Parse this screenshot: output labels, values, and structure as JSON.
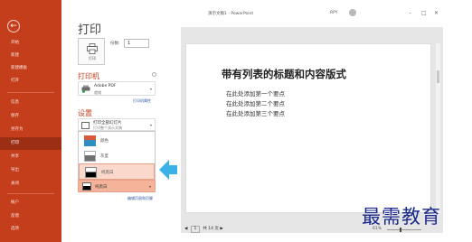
{
  "nav": {
    "items": [
      {
        "label": "开始"
      },
      {
        "label": "新建"
      },
      {
        "label": "新建模板"
      },
      {
        "label": "打开"
      },
      {
        "label": "信息"
      },
      {
        "label": "保存"
      },
      {
        "label": "另存为"
      },
      {
        "label": "打印"
      },
      {
        "label": "共享"
      },
      {
        "label": "导出"
      },
      {
        "label": "关闭"
      },
      {
        "label": "帐户"
      },
      {
        "label": "反馈"
      },
      {
        "label": "选项"
      }
    ],
    "active_index": 7
  },
  "page_title": "打印",
  "print_button": {
    "label": "打印"
  },
  "copies": {
    "label": "份数:",
    "value": "1"
  },
  "printer": {
    "section_title": "打印机",
    "name": "Adobe PDF",
    "status": "就绪",
    "properties_link": "打印机属性"
  },
  "settings": {
    "section_title": "设置",
    "print_range": {
      "title": "打印全部幻灯片",
      "subtitle": "打印整个演示文稿"
    },
    "color_options": [
      {
        "label": "颜色"
      },
      {
        "label": "灰度"
      },
      {
        "label": "纯黑白"
      }
    ],
    "selected_option_index": 2,
    "color_select_value": "纯黑白",
    "edit_header_footer_link": "编辑页眉和页脚"
  },
  "window": {
    "title": "演示文稿1 - PowerPoint",
    "user": "RPY"
  },
  "slide": {
    "title": "带有列表的标题和内容版式",
    "bullets": [
      "在此处添加第一个要点",
      "在此处添加第二个要点",
      "在此处添加第三个要点"
    ]
  },
  "pager": {
    "current": "1",
    "total_text": "共 14 页"
  },
  "zoom": {
    "value_text": "61%"
  },
  "watermark": "最需教育",
  "colors": {
    "accent": "#c43e1c",
    "selected_bg": "#fad9cc",
    "arrow": "#3ab1e8",
    "watermark": "#1b2a8c"
  }
}
